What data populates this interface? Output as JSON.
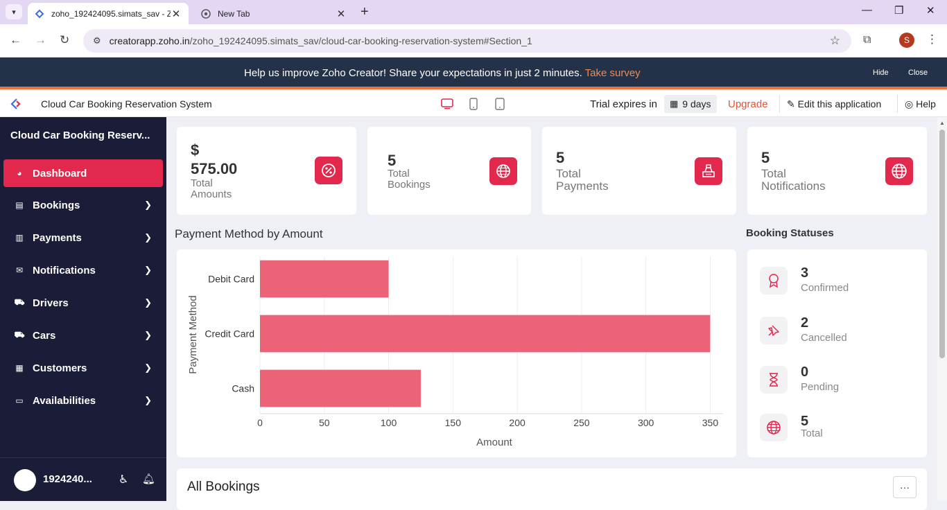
{
  "browser": {
    "tabs": [
      {
        "title": "zoho_192424095.simats_sav - Z",
        "active": true
      },
      {
        "title": "New Tab",
        "active": false
      }
    ],
    "url_host": "creatorapp.zoho.in",
    "url_path": "/zoho_192424095.simats_sav/cloud-car-booking-reservation-system#Section_1",
    "profile_initial": "S"
  },
  "survey": {
    "message": "Help us improve Zoho Creator! Share your expectations in just 2 minutes.",
    "link": "Take survey",
    "hide": "Hide",
    "close": "Close"
  },
  "header": {
    "app_name": "Cloud Car Booking Reservation System",
    "trial_label": "Trial expires in",
    "trial_days": "9 days",
    "upgrade": "Upgrade",
    "edit": "Edit this application",
    "help": "Help"
  },
  "sidebar": {
    "title": "Cloud Car Booking Reserv...",
    "items": [
      {
        "label": "Dashboard",
        "icon": "dashboard-icon"
      },
      {
        "label": "Bookings",
        "icon": "bookings-icon"
      },
      {
        "label": "Payments",
        "icon": "payments-icon"
      },
      {
        "label": "Notifications",
        "icon": "mail-icon"
      },
      {
        "label": "Drivers",
        "icon": "car-icon"
      },
      {
        "label": "Cars",
        "icon": "car-icon"
      },
      {
        "label": "Customers",
        "icon": "customers-icon"
      },
      {
        "label": "Availabilities",
        "icon": "monitor-icon"
      }
    ],
    "user": "1924240..."
  },
  "stats": [
    {
      "value_line1": "$",
      "value_line2": "575.00",
      "label_line1": "Total",
      "label_line2": "Amounts"
    },
    {
      "value": "5",
      "label_line1": "Total",
      "label_line2": "Bookings"
    },
    {
      "value": "5",
      "label_line1": "Total",
      "label_line2": "Payments"
    },
    {
      "value": "5",
      "label_line1": "Total",
      "label_line2": "Notifications"
    }
  ],
  "chart_title": "Payment Method by Amount",
  "chart_data": {
    "type": "bar",
    "orientation": "horizontal",
    "categories": [
      "Debit Card",
      "Credit Card",
      "Cash"
    ],
    "values": [
      100,
      350,
      125
    ],
    "xlabel": "Amount",
    "ylabel": "Payment Method",
    "xlim": [
      0,
      360
    ],
    "xticks": [
      0,
      50,
      100,
      150,
      200,
      250,
      300,
      350
    ],
    "grid": true,
    "bar_color": "#ec6277"
  },
  "booking_statuses": {
    "title": "Booking Statuses",
    "items": [
      {
        "count": "3",
        "label": "Confirmed",
        "icon": "ribbon-icon"
      },
      {
        "count": "2",
        "label": "Cancelled",
        "icon": "pin-icon"
      },
      {
        "count": "0",
        "label": "Pending",
        "icon": "hourglass-icon"
      },
      {
        "count": "5",
        "label": "Total",
        "icon": "globe-icon"
      }
    ]
  },
  "all_bookings": {
    "title": "All Bookings",
    "more": "···"
  },
  "colors": {
    "accent": "#e3284d",
    "sidebar": "#1b1c37",
    "banner": "#233249",
    "survey_link": "#f08a52"
  }
}
